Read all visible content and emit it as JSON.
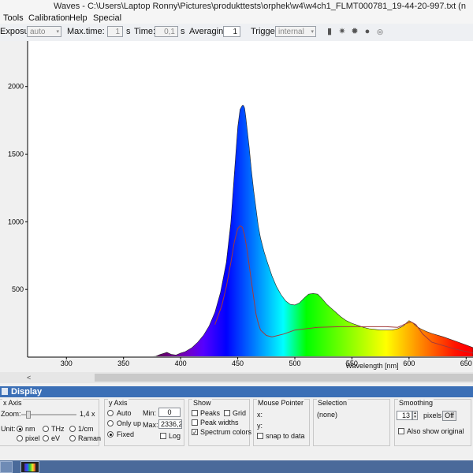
{
  "window": {
    "title": "Waves  -  C:\\Users\\Laptop Ronny\\Pictures\\produkttests\\orphek\\w4\\w4ch1_FLMT000781_19-44-20-997.txt  (n"
  },
  "menu": {
    "items": [
      "Tools",
      "Calibration",
      "Help",
      "Special"
    ]
  },
  "toolbar": {
    "exposure_label": "Exposure:",
    "exposure_value": "auto",
    "maxtime_label": "Max.time:",
    "maxtime_value": "1",
    "maxtime_unit": "s",
    "time_label": "Time:",
    "time_value": "0,1",
    "time_unit": "s",
    "averaging_label": "Averaging:",
    "averaging_value": "1",
    "trigger_label": "Trigger:",
    "trigger_value": "internal",
    "icons": [
      "save-icon",
      "sun-icon",
      "sun-dark-icon",
      "record-icon",
      "stop-icon"
    ]
  },
  "chart_data": {
    "type": "area",
    "xlabel": "Wavelength [nm]",
    "ylabel": "",
    "xlim": [
      266,
      656
    ],
    "ylim": [
      0,
      2336.2
    ],
    "x_ticks": [
      300,
      350,
      400,
      450,
      500,
      550,
      600,
      650
    ],
    "y_ticks": [
      500,
      1000,
      1500,
      2000
    ],
    "fill": "spectrum colors",
    "series": [
      {
        "x": [
          370,
          378,
          382,
          386,
          388,
          392,
          396,
          400,
          404,
          410,
          415,
          420,
          425,
          430,
          435,
          440,
          444,
          447,
          450,
          452,
          454,
          455,
          456,
          457,
          458,
          460,
          462,
          464,
          466,
          468,
          470,
          473,
          476,
          480,
          484,
          488,
          492,
          496,
          500,
          504,
          508,
          512,
          516,
          520,
          524,
          528,
          532,
          536,
          540,
          545,
          550,
          555,
          560,
          565,
          570,
          575,
          580,
          585,
          590,
          595,
          598,
          600,
          603,
          606,
          610,
          615,
          620,
          630,
          640,
          650,
          656
        ],
        "values": [
          2,
          5,
          20,
          30,
          35,
          20,
          15,
          30,
          40,
          70,
          110,
          160,
          230,
          330,
          480,
          700,
          1000,
          1350,
          1700,
          1830,
          1860,
          1860,
          1840,
          1780,
          1700,
          1550,
          1380,
          1230,
          1100,
          970,
          880,
          780,
          700,
          600,
          520,
          460,
          415,
          390,
          385,
          400,
          435,
          465,
          470,
          465,
          430,
          390,
          360,
          330,
          300,
          270,
          250,
          235,
          220,
          210,
          205,
          200,
          200,
          200,
          210,
          230,
          255,
          270,
          255,
          230,
          210,
          190,
          175,
          150,
          120,
          90,
          70
        ]
      },
      {
        "x": [
          430,
          436,
          440,
          444,
          447,
          450,
          452,
          454,
          456,
          458,
          460,
          462,
          464,
          466,
          468,
          470,
          475,
          480,
          490,
          500,
          520,
          540,
          560,
          580,
          590,
          598,
          602,
          606,
          612,
          620,
          640,
          656
        ],
        "values": [
          240,
          380,
          520,
          700,
          850,
          950,
          970,
          960,
          900,
          800,
          680,
          560,
          440,
          320,
          250,
          200,
          160,
          150,
          170,
          200,
          220,
          225,
          225,
          225,
          220,
          250,
          260,
          240,
          170,
          110,
          60,
          30
        ]
      }
    ]
  },
  "scrollbar": {
    "left_arrow": "<"
  },
  "display": {
    "title": "Display",
    "xaxis": {
      "title": "x Axis",
      "zoom_label": "Zoom:",
      "zoom_value": "1,4 x",
      "zoom_level": 0.1,
      "unit_label": "Unit:",
      "units": [
        "nm",
        "THz",
        "1/cm",
        "pixel",
        "eV",
        "Raman"
      ],
      "selected_unit": "nm"
    },
    "yaxis": {
      "title": "y Axis",
      "options": [
        "Auto",
        "Only up",
        "Fixed"
      ],
      "selected": "Fixed",
      "min_label": "Min:",
      "min_value": "0",
      "max_label": "Max:",
      "max_value": "2336,20",
      "log_label": "Log"
    },
    "show": {
      "title": "Show",
      "items": [
        {
          "label": "Peaks",
          "checked": false
        },
        {
          "label": "Grid",
          "checked": false
        },
        {
          "label": "Peak widths",
          "checked": false
        },
        {
          "label": "Spectrum colors",
          "checked": true
        }
      ]
    },
    "mouse": {
      "title": "Mouse Pointer",
      "x_label": "x:",
      "y_label": "y:",
      "snap_label": "snap to data"
    },
    "selection": {
      "title": "Selection",
      "value": "(none)"
    },
    "smoothing": {
      "title": "Smoothing",
      "value": "13",
      "unit": "pixels",
      "off_label": "Off",
      "also_label": "Also show original"
    }
  },
  "colors": {
    "peak_outline": "#a23a3a",
    "display_bar": "#3b6fb6",
    "taskbar": "#4a6a9a"
  }
}
